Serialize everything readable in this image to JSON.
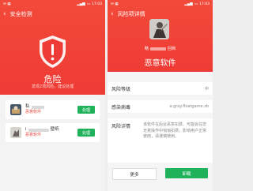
{
  "left": {
    "status_time": "17:03",
    "title": "安全检测",
    "danger_title": "危险",
    "danger_sub": "发现2项风险，建议处理",
    "apps": [
      {
        "name": "私",
        "tag": "恶意软件",
        "action": "处理"
      },
      {
        "name": "i",
        "name_suffix": "壁纸",
        "tag": "恶意软件",
        "action": "处理"
      }
    ]
  },
  "right": {
    "status_time": "17:03",
    "title": "风险项详情",
    "app_name_prefix": "略",
    "app_name_suffix": "回档",
    "malware_label": "恶意软件",
    "risk_level_label": "风险等级",
    "risk_level_value": "中",
    "virus_label": "感染病毒",
    "virus_value": "a.gray.floatgame.zb",
    "detail_label": "风险详情",
    "detail_text": "该软件在后台恶意扣费、可能会在您无意操作中悄悄扣费，影响用户正常使用，请谨慎使用。",
    "more_label": "更多",
    "uninstall_label": "卸载"
  },
  "colors": {
    "danger": "#ef3b35",
    "action": "#1fb25a"
  }
}
